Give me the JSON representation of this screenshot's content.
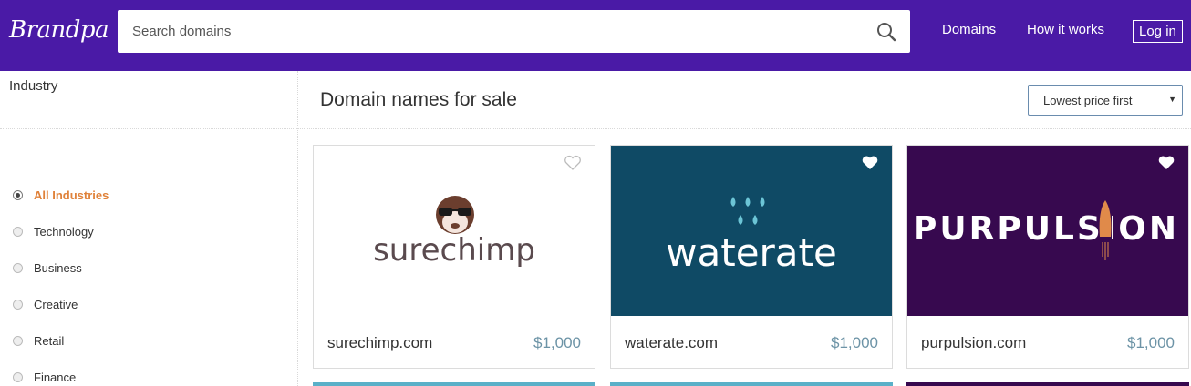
{
  "header": {
    "logo": "Brandpa",
    "search_placeholder": "Search domains",
    "nav": {
      "domains": "Domains",
      "how_it_works": "How it works",
      "login": "Log in"
    }
  },
  "sidebar": {
    "industry_title": "Industry",
    "items": [
      {
        "label": "All Industries",
        "selected": true
      },
      {
        "label": "Technology",
        "selected": false
      },
      {
        "label": "Business",
        "selected": false
      },
      {
        "label": "Creative",
        "selected": false
      },
      {
        "label": "Retail",
        "selected": false
      },
      {
        "label": "Finance",
        "selected": false
      }
    ]
  },
  "main": {
    "title": "Domain names for sale",
    "sort": "Lowest price first"
  },
  "cards": [
    {
      "logo_text": "surechimp",
      "domain": "surechimp.com",
      "price": "$1,000",
      "bg": "#ffffff",
      "favorited": false
    },
    {
      "logo_text": "waterate",
      "domain": "waterate.com",
      "price": "$1,000",
      "bg": "#0f4a65",
      "favorited": true
    },
    {
      "logo_text": "PURPULSION",
      "domain": "purpulsion.com",
      "price": "$1,000",
      "bg": "#37094f",
      "favorited": true
    }
  ],
  "colors": {
    "header_bg": "#4a1aa6",
    "accent": "#e0823a",
    "price": "#6c93a6"
  }
}
